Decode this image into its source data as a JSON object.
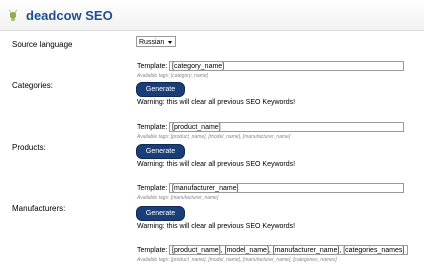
{
  "header": {
    "title": "deadcow SEO",
    "icon": "deer-icon"
  },
  "source_language": {
    "label": "Source language",
    "value": "Russian"
  },
  "template_label": "Template:",
  "generate_label": "Generate",
  "warning": "Warning: this will clear all previous SEO Keywords!",
  "sections": [
    {
      "label": "Categories:",
      "template": "[category_name]",
      "available": "Available tags: [category_name]"
    },
    {
      "label": "Products:",
      "template": "[product_name]",
      "available": "Available tags: [product_name], [model_name], [manufacturer_name]"
    },
    {
      "label": "Manufacturers:",
      "template": "[manufacturer_name]",
      "available": "Available tags: [manufacturer_name]"
    },
    {
      "label": "",
      "template": "[product_name], [model_name], [manufacturer_name], [categories_names]",
      "available": "Available tags: [product_name], [model_name], [manufacturer_name], [categories_names]"
    }
  ]
}
